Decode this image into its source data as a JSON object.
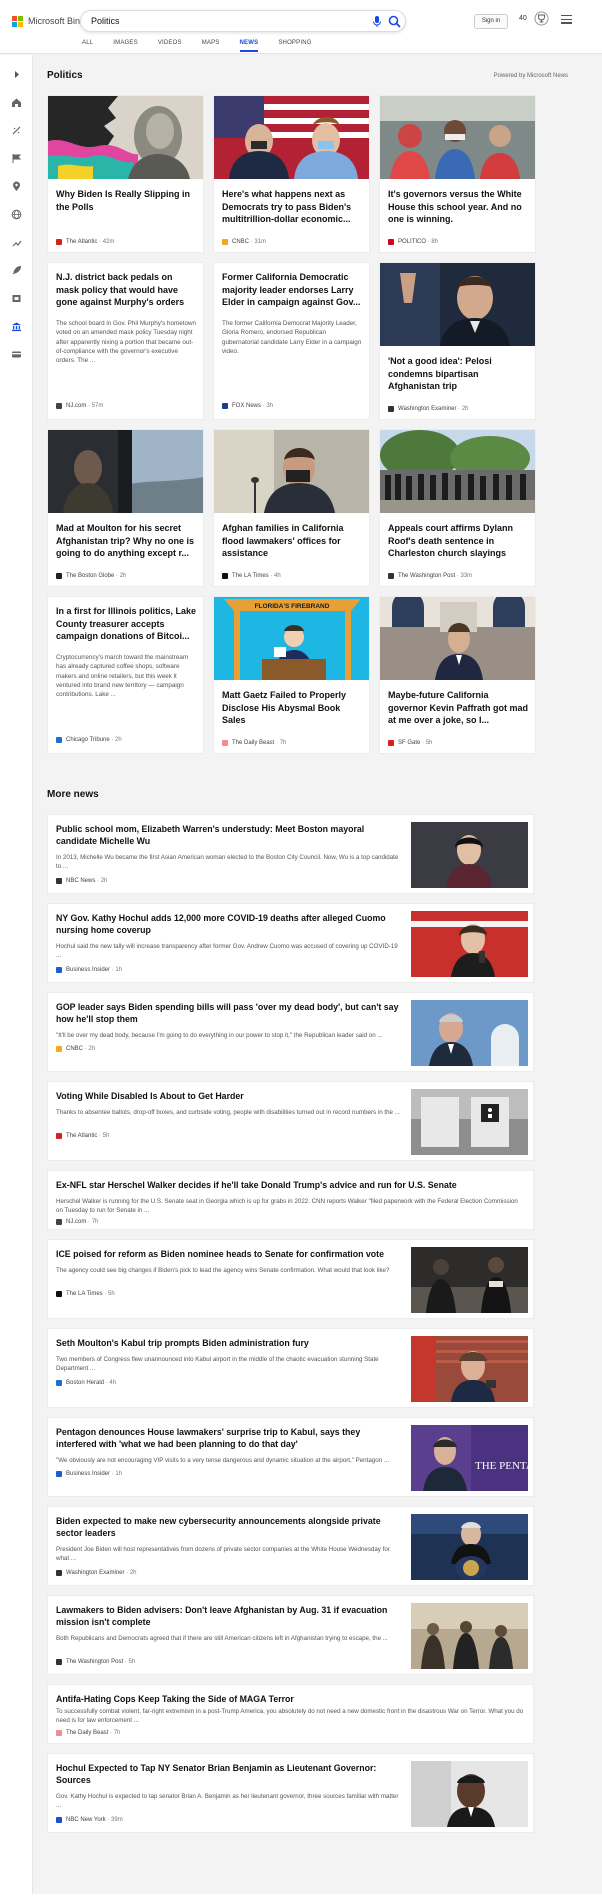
{
  "header": {
    "brand": "Microsoft Bing",
    "search_query": "Politics",
    "signin_label": "Sign in",
    "rewards_count": "40"
  },
  "tabs": [
    {
      "label": "ALL"
    },
    {
      "label": "IMAGES"
    },
    {
      "label": "VIDEOS"
    },
    {
      "label": "MAPS"
    },
    {
      "label": "NEWS"
    },
    {
      "label": "SHOPPING"
    }
  ],
  "rail_icons": [
    "chevron-right-icon",
    "home-icon",
    "medical-icon",
    "flag-icon",
    "location-pin-icon",
    "globe-icon",
    "dollar-icon",
    "rocket-icon",
    "film-icon",
    "bank-icon",
    "credit-card-icon"
  ],
  "section": {
    "title": "Politics",
    "powered_by": "Powered by Microsoft News"
  },
  "cards": [
    {
      "title": "Why Biden Is Really Slipping in the Polls",
      "snippet": "",
      "source": "The Atlantic",
      "time": "42m",
      "fav": "#d62020",
      "image": true
    },
    {
      "title": "Here's what happens next as Democrats try to pass Biden's multitrillion-dollar economic...",
      "snippet": "",
      "source": "CNBC",
      "time": "31m",
      "fav": "#f5a623",
      "image": true
    },
    {
      "title": "It's governors versus the White House this school year. And no one is winning.",
      "snippet": "",
      "source": "POLITICO",
      "time": "8h",
      "fav": "#d0021b",
      "image": true
    },
    {
      "title": "N.J. district back pedals on mask policy that would have gone against Murphy's orders",
      "snippet": "The school board in Gov. Phil Murphy's hometown voted on an amended mask policy Tuesday night after apparently nixing a portion that became out-of-compliance with the governor's executive orders. The ...",
      "source": "NJ.com",
      "time": "57m",
      "fav": "#444",
      "image": false
    },
    {
      "title": "Former California Democratic majority leader endorses Larry Elder in campaign against Gov...",
      "snippet": "The former California Democrat Majority Leader, Gloria Romero, endorsed Republican gubernatorial candidate Larry Elder in a campaign video.",
      "source": "FOX News",
      "time": "3h",
      "fav": "#1a3e8c",
      "image": false
    },
    {
      "title": "'Not a good idea': Pelosi condemns bipartisan Afghanistan trip",
      "snippet": "",
      "source": "Washington Examiner",
      "time": "2h",
      "fav": "#333",
      "image": true
    },
    {
      "title": "Mad at Moulton for his secret Afghanistan trip? Why no one is going to do anything except r...",
      "snippet": "",
      "source": "The Boston Globe",
      "time": "2h",
      "fav": "#222",
      "image": true
    },
    {
      "title": "Afghan families in California flood lawmakers' offices for assistance",
      "snippet": "",
      "source": "The LA Times",
      "time": "4h",
      "fav": "#111",
      "image": true
    },
    {
      "title": "Appeals court affirms Dylann Roof's death sentence in Charleston church slayings",
      "snippet": "",
      "source": "The Washington Post",
      "time": "33m",
      "fav": "#333",
      "image": true
    },
    {
      "title": "In a first for Illinois politics, Lake County treasurer accepts campaign donations of Bitcoi...",
      "snippet": "Cryptocurrency's march toward the mainstream has already captured coffee shops, software makers and online retailers, but this week it ventured into brand new territory — campaign contributions. Lake ...",
      "source": "Chicago Tribune",
      "time": "2h",
      "fav": "#1d6fd1",
      "image": false
    },
    {
      "title": "Matt Gaetz Failed to Properly Disclose His Abysmal Book Sales",
      "snippet": "",
      "source": "The Daily Beast",
      "time": "7h",
      "fav": "#f28b8b",
      "image": true
    },
    {
      "title": "Maybe-future California governor Kevin Paffrath got mad at me over a joke, so I...",
      "snippet": "",
      "source": "SF Gate",
      "time": "5h",
      "fav": "#d62020",
      "image": true
    }
  ],
  "illustration_sign": "FLORIDA'S FIREBRAND",
  "more_news": {
    "title": "More news",
    "items": [
      {
        "title": "Public school mom, Elizabeth Warren's understudy: Meet Boston mayoral candidate Michelle Wu",
        "snippet": "In 2013, Michelle Wu became the first Asian American woman elected to the Boston City Council. Now, Wu is a top candidate to ...",
        "source": "NBC News",
        "time": "2h",
        "fav": "#333",
        "thumb": true
      },
      {
        "title": "NY Gov. Kathy Hochul adds 12,000 more COVID-19 deaths after alleged Cuomo nursing home coverup",
        "snippet": "Hochul said the new tally will increase transparency after former Gov. Andrew Cuomo was accused of covering up COVID-19 ...",
        "source": "Business Insider",
        "time": "1h",
        "fav": "#1d5ed8",
        "thumb": true
      },
      {
        "title": "GOP leader says Biden spending bills will pass 'over my dead body', but can't say how he'll stop them",
        "snippet": "\"It'll be over my dead body, because I'm going to do everything in our power to stop it,\" the Republican leader said on ...",
        "source": "CNBC",
        "time": "2h",
        "fav": "#f5a623",
        "thumb": true
      },
      {
        "title": "Voting While Disabled Is About to Get Harder",
        "snippet": "Thanks to absentee ballots, drop-off boxes, and curbside voting, people with disabilities turned out in record numbers in the ...",
        "source": "The Atlantic",
        "time": "5h",
        "fav": "#d62020",
        "thumb": true
      },
      {
        "title": "Ex-NFL star Herschel Walker decides if he'll take Donald Trump's advice and run for U.S. Senate",
        "snippet": "Herschel Walker is running for the U.S. Senate seat in Georgia which is up for grabs in 2022. CNN reports Walker \"filed paperwork with the Federal Election Commission on Tuesday to run for Senate in ...",
        "source": "NJ.com",
        "time": "7h",
        "fav": "#444",
        "thumb": false
      },
      {
        "title": "ICE poised for reform as Biden nominee heads to Senate for confirmation vote",
        "snippet": "The agency could see big changes if Biden's pick to lead the agency wins Senate confirmation. What would that look like?",
        "source": "The LA Times",
        "time": "5h",
        "fav": "#111",
        "thumb": true
      },
      {
        "title": "Seth Moulton's Kabul trip prompts Biden administration fury",
        "snippet": "Two members of Congress flew unannounced into Kabul airport in the middle of the chaotic evacuation stunning State Department ...",
        "source": "Boston Herald",
        "time": "4h",
        "fav": "#1d6fd1",
        "thumb": true
      },
      {
        "title": "Pentagon denounces House lawmakers' surprise trip to Kabul, says they interfered with 'what we had been planning to do that day'",
        "snippet": "\"We obviously are not encouraging VIP visits to a very tense dangerous and dynamic situation at the airport,\" Pentagon ...",
        "source": "Business Insider",
        "time": "1h",
        "fav": "#1d5ed8",
        "thumb": true
      },
      {
        "title": "Biden expected to make new cybersecurity announcements alongside private sector leaders",
        "snippet": "President Joe Biden will host representatives from dozens of private sector companies at the White House Wednesday for what ...",
        "source": "Washington Examiner",
        "time": "2h",
        "fav": "#333",
        "thumb": true
      },
      {
        "title": "Lawmakers to Biden advisers: Don't leave Afghanistan by Aug. 31 if evacuation mission isn't complete",
        "snippet": "Both Republicans and Democrats agreed that if there are still American citizens left in Afghanistan trying to escape, the ...",
        "source": "The Washington Post",
        "time": "5h",
        "fav": "#333",
        "thumb": true
      },
      {
        "title": "Antifa-Hating Cops Keep Taking the Side of MAGA Terror",
        "snippet": "To successfully combat violent, far-right extremism in a post-Trump America, you absolutely do not need a new domestic front in the disastrous War on Terror. What you do need is for law enforcement ...",
        "source": "The Daily Beast",
        "time": "7h",
        "fav": "#f28b8b",
        "thumb": false
      },
      {
        "title": "Hochul Expected to Tap NY Senator Brian Benjamin as Lieutenant Governor: Sources",
        "snippet": "Gov. Kathy Hochul is expected to tap senator Brian A. Benjamin as her lieutenant governor, three sources familiar with matter ...",
        "source": "NBC New York",
        "time": "39m",
        "fav": "#1d4ed8",
        "thumb": true
      }
    ]
  }
}
